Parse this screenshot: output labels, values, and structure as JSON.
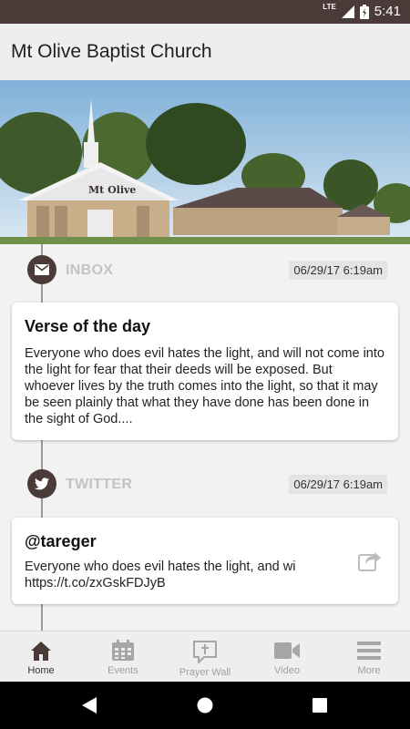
{
  "status_bar": {
    "time": "5:41",
    "network": "LTE"
  },
  "app_bar": {
    "title": "Mt Olive Baptist Church"
  },
  "hero": {
    "sign_text": "Mt Olive"
  },
  "feed": [
    {
      "source": "INBOX",
      "icon": "envelope-icon",
      "timestamp": "06/29/17 6:19am",
      "title": "Verse of the day",
      "body": "Everyone who does evil hates the light, and will not come into the light for fear that their deeds will be exposed. But whoever lives by the truth comes into the light, so that it may be seen plainly that what they have done has been done in the sight of God...."
    },
    {
      "source": "TWITTER",
      "icon": "twitter-bird-icon",
      "timestamp": "06/29/17 6:19am",
      "title": "@tareger",
      "body_line1": "Everyone who does evil hates the light, and wi",
      "body_line2": "https://t.co/zxGskFDJyB"
    }
  ],
  "bottom_nav": [
    {
      "label": "Home",
      "icon": "home-icon",
      "active": true
    },
    {
      "label": "Events",
      "icon": "calendar-icon",
      "active": false
    },
    {
      "label": "Prayer Wall",
      "icon": "prayer-cross-bubble-icon",
      "active": false
    },
    {
      "label": "Video",
      "icon": "video-camera-icon",
      "active": false
    },
    {
      "label": "More",
      "icon": "menu-icon",
      "active": false
    }
  ],
  "colors": {
    "brand": "#4a3b39",
    "app_bar_bg": "#eeeeee",
    "muted_text": "#c4c4c4"
  }
}
